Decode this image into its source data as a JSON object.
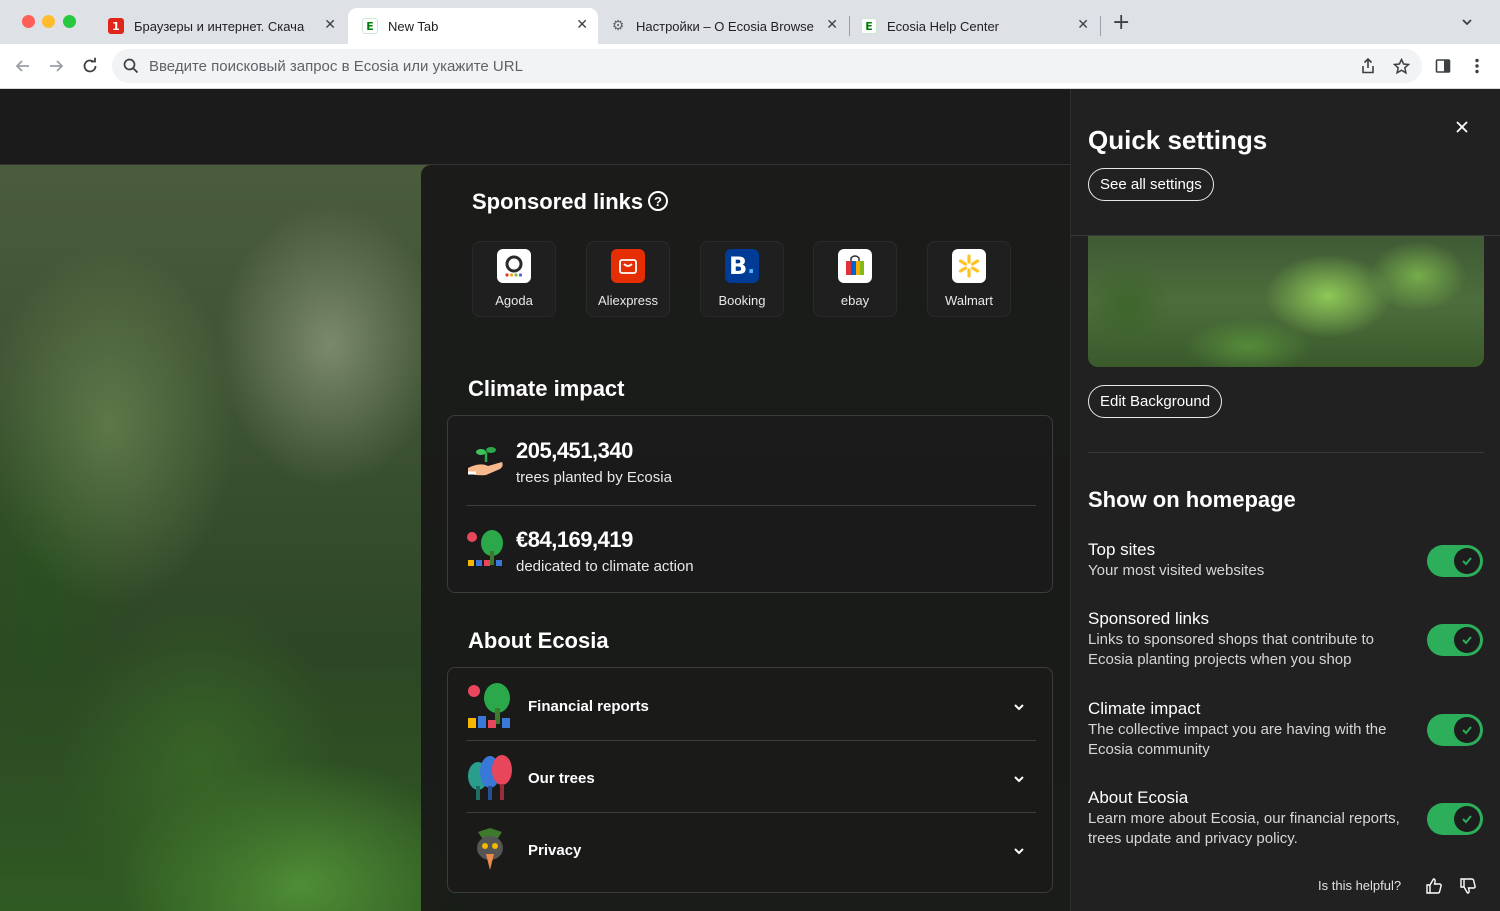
{
  "browser": {
    "tabs": [
      {
        "title": "Браузеры и интернет. Скача",
        "favicon": "softonic-icon",
        "active": false
      },
      {
        "title": "New Tab",
        "favicon": "ecosia-icon",
        "active": true
      },
      {
        "title": "Настройки – О Ecosia Browse",
        "favicon": "gear-icon",
        "active": false
      },
      {
        "title": "Ecosia Help Center",
        "favicon": "ecosia-icon",
        "active": false
      }
    ],
    "omnibox_placeholder": "Введите поисковый запрос в Ecosia или укажите URL"
  },
  "sponsored": {
    "title": "Sponsored links",
    "sites": [
      {
        "label": "Agoda",
        "color": "#ffffff"
      },
      {
        "label": "Aliexpress",
        "color": "#e62e04"
      },
      {
        "label": "Booking",
        "color": "#003b95"
      },
      {
        "label": "ebay",
        "color": "#ffffff"
      },
      {
        "label": "Walmart",
        "color": "#ffffff"
      }
    ]
  },
  "climate": {
    "title": "Climate impact",
    "trees_value": "205,451,340",
    "trees_label": "trees planted by Ecosia",
    "money_value": "€84,169,419",
    "money_label": "dedicated to climate action"
  },
  "about": {
    "title": "About Ecosia",
    "items": [
      {
        "label": "Financial reports"
      },
      {
        "label": "Our trees"
      },
      {
        "label": "Privacy"
      }
    ]
  },
  "quick_settings": {
    "title": "Quick settings",
    "see_all_label": "See all settings",
    "edit_background_label": "Edit Background",
    "show_title": "Show on homepage",
    "prefs": [
      {
        "title": "Top sites",
        "desc": "Your most visited websites",
        "enabled": true
      },
      {
        "title": "Sponsored links",
        "desc": "Links to sponsored shops that contribute to Ecosia planting projects when you shop",
        "enabled": true
      },
      {
        "title": "Climate impact",
        "desc": "The collective impact you are having with the Ecosia community",
        "enabled": true
      },
      {
        "title": "About Ecosia",
        "desc": "Learn more about Ecosia, our financial reports, trees update and privacy policy.",
        "enabled": true
      }
    ],
    "helpful_label": "Is this helpful?"
  },
  "colors": {
    "accent_green": "#2cae5b",
    "panel_bg": "#212121"
  }
}
